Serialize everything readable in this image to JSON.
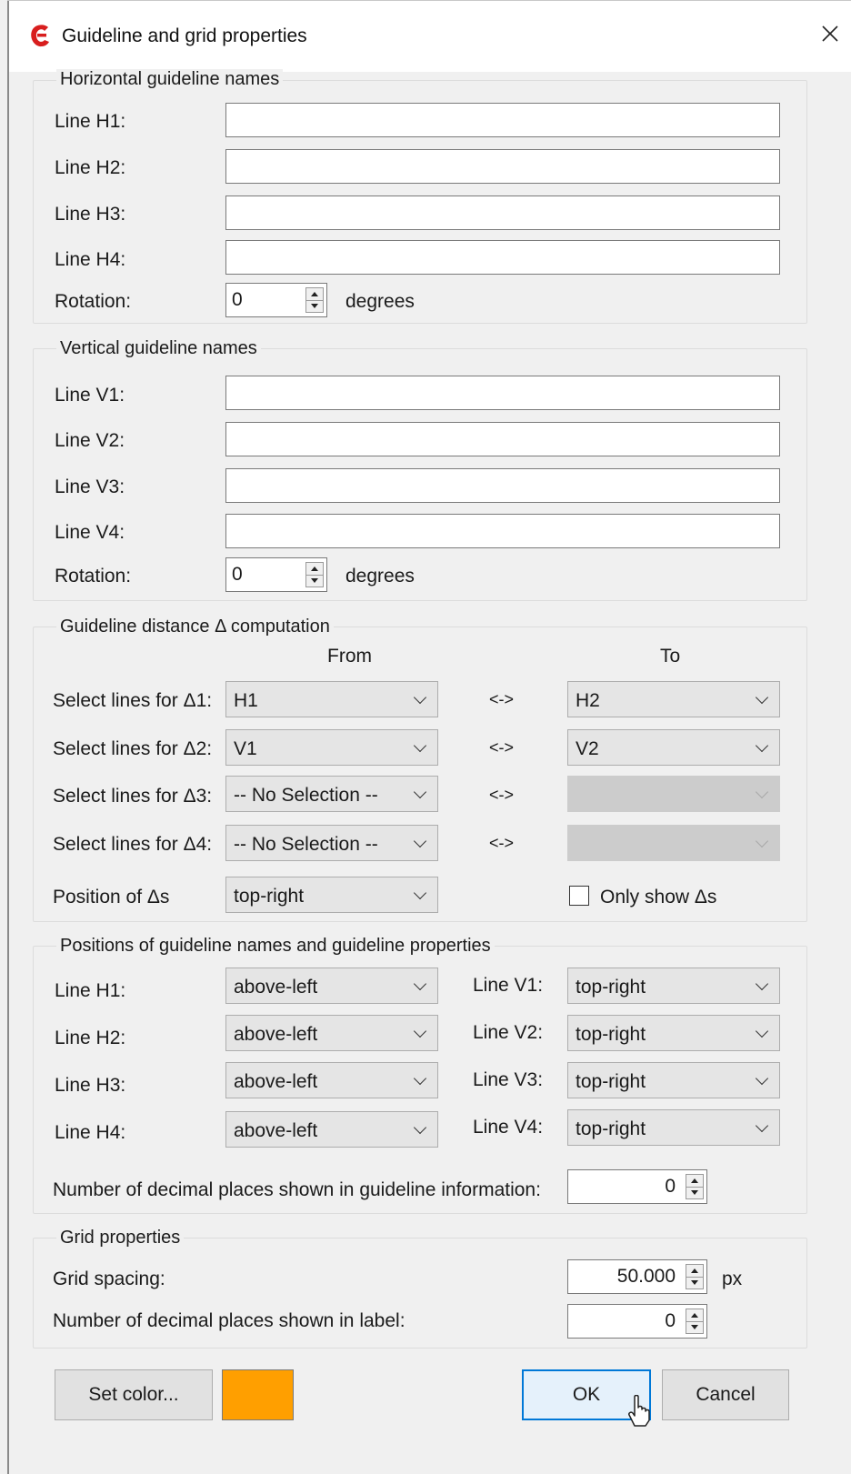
{
  "window": {
    "title": "Guideline and grid properties",
    "logo_icon": "app-logo-icon",
    "close_icon": "close-icon"
  },
  "horizontal": {
    "legend": "Horizontal guideline names",
    "lines": [
      {
        "label": "Line H1:",
        "value": ""
      },
      {
        "label": "Line H2:",
        "value": ""
      },
      {
        "label": "Line H3:",
        "value": ""
      },
      {
        "label": "Line H4:",
        "value": ""
      }
    ],
    "rotation_label": "Rotation:",
    "rotation_value": "0",
    "rotation_unit": "degrees"
  },
  "vertical": {
    "legend": "Vertical guideline names",
    "lines": [
      {
        "label": "Line V1:",
        "value": ""
      },
      {
        "label": "Line V2:",
        "value": ""
      },
      {
        "label": "Line V3:",
        "value": ""
      },
      {
        "label": "Line V4:",
        "value": ""
      }
    ],
    "rotation_label": "Rotation:",
    "rotation_value": "0",
    "rotation_unit": "degrees"
  },
  "distance": {
    "legend": "Guideline distance Δ computation",
    "from_header": "From",
    "to_header": "To",
    "separator": "<->",
    "rows": [
      {
        "label": "Select lines for Δ1:",
        "from": "H1",
        "to": "H2"
      },
      {
        "label": "Select lines for Δ2:",
        "from": "V1",
        "to": "V2"
      },
      {
        "label": "Select lines for Δ3:",
        "from": "-- No Selection --",
        "to": ""
      },
      {
        "label": "Select lines for Δ4:",
        "from": "-- No Selection --",
        "to": ""
      }
    ],
    "position_label": "Position of Δs",
    "position_value": "top-right",
    "only_show_label": "Only show Δs",
    "only_show_checked": false
  },
  "positions": {
    "legend": "Positions of guideline names and guideline properties",
    "h_lines": [
      {
        "label": "Line H1:",
        "value": "above-left"
      },
      {
        "label": "Line H2:",
        "value": "above-left"
      },
      {
        "label": "Line H3:",
        "value": "above-left"
      },
      {
        "label": "Line H4:",
        "value": "above-left"
      }
    ],
    "v_lines": [
      {
        "label": "Line V1:",
        "value": "top-right"
      },
      {
        "label": "Line V2:",
        "value": "top-right"
      },
      {
        "label": "Line V3:",
        "value": "top-right"
      },
      {
        "label": "Line V4:",
        "value": "top-right"
      }
    ],
    "decimals_label": "Number of decimal places shown in guideline information:",
    "decimals_value": "0"
  },
  "grid": {
    "legend": "Grid properties",
    "spacing_label": "Grid spacing:",
    "spacing_value": "50.000",
    "spacing_unit": "px",
    "decimals_label": "Number of decimal places shown in label:",
    "decimals_value": "0"
  },
  "buttons": {
    "set_color": "Set color...",
    "swatch_color": "#ff9f00",
    "ok": "OK",
    "cancel": "Cancel"
  }
}
